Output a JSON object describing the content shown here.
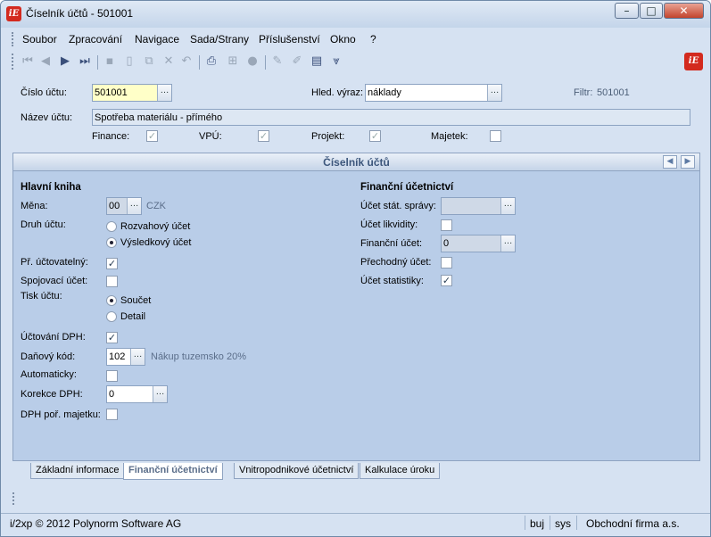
{
  "window": {
    "title": "Číselník účtů - 501001",
    "app_icon": "iE"
  },
  "menu": [
    "Soubor",
    "Zpracování",
    "Navigace",
    "Sada/Strany",
    "Příslušenství",
    "Okno",
    "?"
  ],
  "header": {
    "cislo_uctu_label": "Číslo účtu:",
    "cislo_uctu_value": "501001",
    "hled_vyraz_label": "Hled. výraz:",
    "hled_vyraz_value": "náklady",
    "filtr_label": "Filtr:",
    "filtr_value": "501001",
    "nazev_uctu_label": "Název účtu:",
    "nazev_uctu_value": "Spotřeba materiálu - přímého",
    "finance_label": "Finance:",
    "vpu_label": "VPÚ:",
    "projekt_label": "Projekt:",
    "majetek_label": "Majetek:",
    "finance_checked": true,
    "vpu_checked": true,
    "projekt_checked": true,
    "majetek_checked": false
  },
  "panel": {
    "title": "Číselník účtů",
    "left_heading": "Hlavní kniha",
    "mena_label": "Měna:",
    "mena_value": "00",
    "mena_name": "CZK",
    "druh_label": "Druh účtu:",
    "druh_options": [
      "Rozvahový účet",
      "Výsledkový účet"
    ],
    "druh_selected": 1,
    "pr_uctovatelny_label": "Př. účtovatelný:",
    "spojovaci_label": "Spojovací účet:",
    "tisk_label": "Tisk účtu:",
    "tisk_options": [
      "Součet",
      "Detail"
    ],
    "tisk_selected": 0,
    "uctovani_dph_label": "Účtování DPH:",
    "danovy_kod_label": "Daňový kód:",
    "danovy_kod_value": "102",
    "danovy_kod_name": "Nákup tuzemsko 20%",
    "automaticky_label": "Automaticky:",
    "korekce_label": "Korekce DPH:",
    "korekce_value": "0",
    "dph_majetku_label": "DPH poř. majetku:",
    "right_heading": "Finanční účetnictví",
    "ucet_stat_label": "Účet stát. správy:",
    "ucet_likvidity_label": "Účet likvidity:",
    "financni_ucet_label": "Finanční účet:",
    "financni_ucet_value": "0",
    "prechodny_label": "Přechodný účet:",
    "ucet_statistiky_label": "Účet statistiky:"
  },
  "tabs": [
    "Základní informace",
    "Finanční účetnictví",
    "Vnitropodnikové účetnictví",
    "Kalkulace úroku"
  ],
  "status": {
    "copyright": "i/2xp © 2012 Polynorm Software AG",
    "user": "buj",
    "db": "sys",
    "company": "Obchodní firma a.s."
  },
  "colors": {
    "accent": "#3d577c",
    "field_highlight": "#ffffc8",
    "panel_bg": "#b9cde8"
  }
}
